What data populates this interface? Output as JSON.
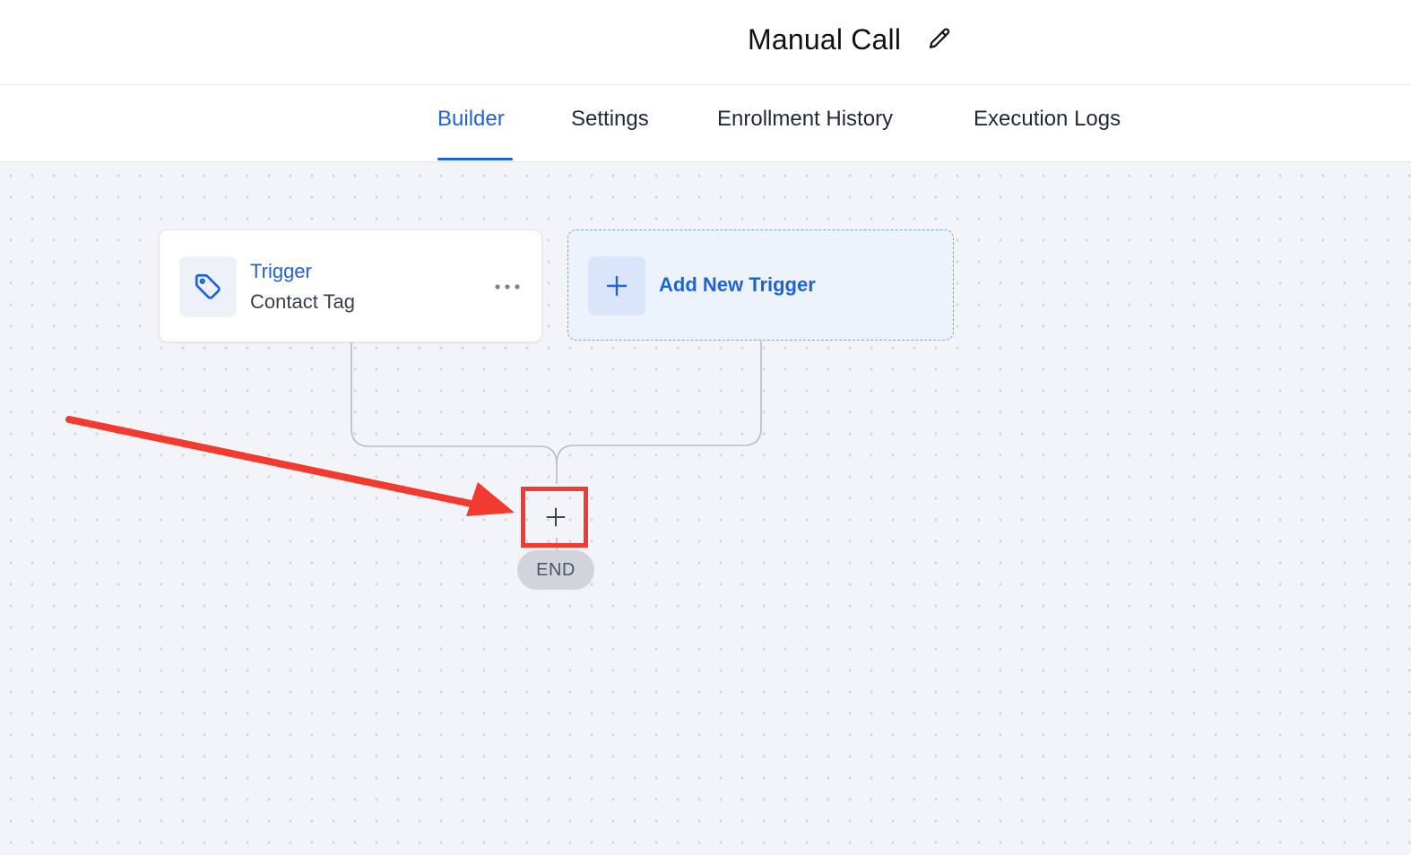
{
  "header": {
    "title": "Manual Call",
    "edit_icon": "pencil-icon"
  },
  "tabs": [
    {
      "label": "Builder",
      "active": true
    },
    {
      "label": "Settings",
      "active": false
    },
    {
      "label": "Enrollment History",
      "active": false
    },
    {
      "label": "Execution Logs",
      "active": false
    }
  ],
  "workflow": {
    "trigger": {
      "title": "Trigger",
      "subtitle": "Contact Tag",
      "icon": "tag-icon",
      "menu_icon": "more-horizontal-icon"
    },
    "add_trigger": {
      "label": "Add New Trigger",
      "icon": "plus-icon"
    },
    "add_step_icon": "plus-icon",
    "end_label": "END"
  },
  "annotation": {
    "arrow_color": "#f23a2e",
    "highlight_color": "#f23a2e"
  },
  "colors": {
    "accent": "#1d63d8",
    "canvas_bg": "#f3f4f7",
    "end_badge_bg": "#d1d5db"
  }
}
